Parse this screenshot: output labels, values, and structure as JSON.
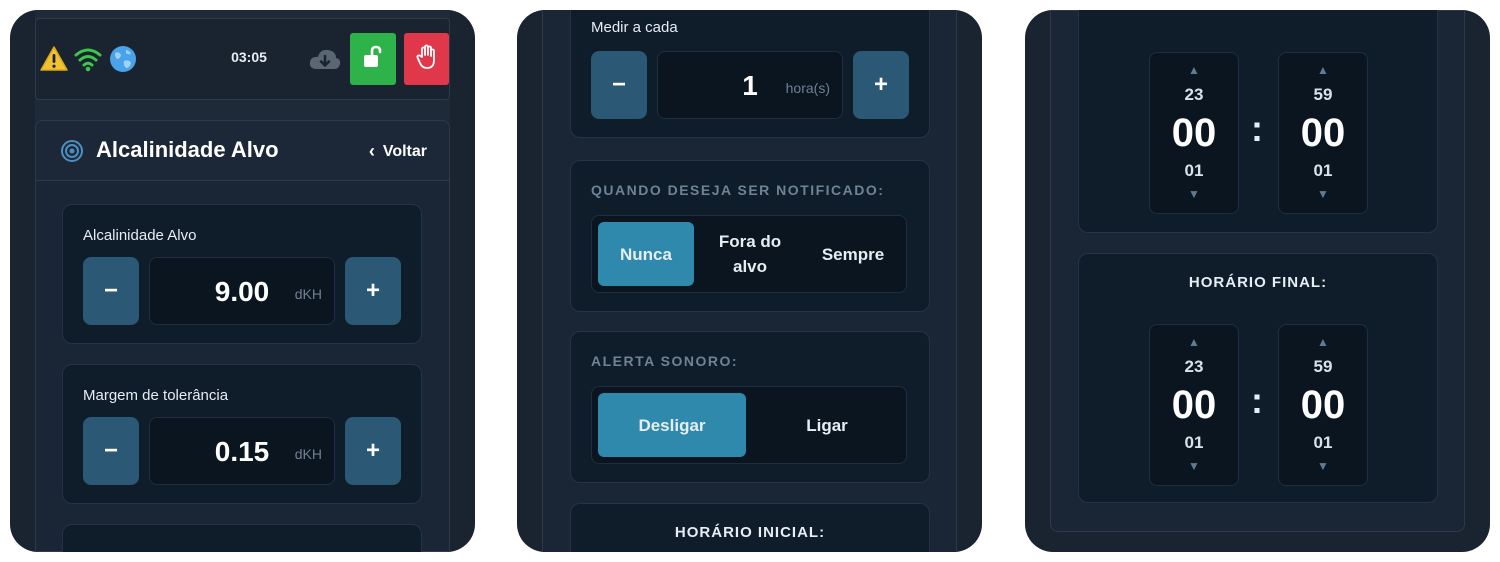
{
  "status_bar": {
    "time": "03:05",
    "icons": [
      "warning-icon",
      "wifi-icon",
      "globe-icon",
      "cloud-download-icon",
      "unlock-icon",
      "hand-stop-icon"
    ],
    "colors": {
      "unlock": "#2db34a",
      "stop": "#e0384a"
    }
  },
  "header": {
    "title": "Alcalinidade Alvo",
    "back_label": "Voltar"
  },
  "target": {
    "label": "Alcalinidade Alvo",
    "value": "9.00",
    "unit": "dKH",
    "minus": "−",
    "plus": "+"
  },
  "tolerance": {
    "label": "Margem de tolerância",
    "value": "0.15",
    "unit": "dKH",
    "minus": "−",
    "plus": "+"
  },
  "measure": {
    "label": "Medir a cada",
    "value": "1",
    "unit": "hora(s)",
    "minus": "−",
    "plus": "+"
  },
  "notify": {
    "title": "QUANDO DESEJA SER NOTIFICADO:",
    "options": [
      "Nunca",
      "Fora do\nalvo",
      "Sempre"
    ],
    "selected": "Nunca"
  },
  "sound": {
    "title": "ALERTA SONORO:",
    "options": [
      "Desligar",
      "Ligar"
    ],
    "selected": "Desligar"
  },
  "start_time": {
    "title": "HORÁRIO INICIAL:",
    "hour": {
      "prev": "23",
      "value": "00",
      "next": "01"
    },
    "minute": {
      "prev": "59",
      "value": "00",
      "next": "01"
    }
  },
  "end_time": {
    "title": "HORÁRIO FINAL:",
    "hour": {
      "prev": "23",
      "value": "00",
      "next": "01"
    },
    "minute": {
      "prev": "59",
      "value": "00",
      "next": "01"
    },
    "separator": ":"
  },
  "arrows": {
    "up": "▲",
    "down": "▼"
  },
  "accent": "#2e89ad"
}
